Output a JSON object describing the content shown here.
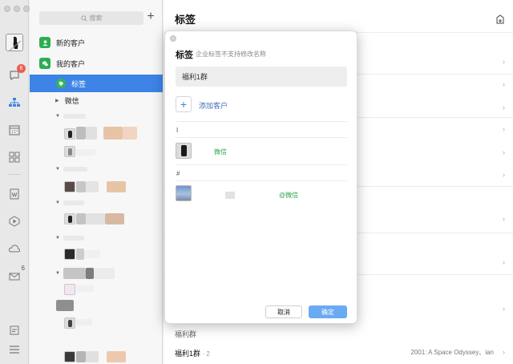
{
  "sidebar": {
    "rail_badges": {
      "messages": "6",
      "mail": "6"
    },
    "search_placeholder": "搜索",
    "items": [
      {
        "label": "新的客户"
      },
      {
        "label": "我的客户"
      },
      {
        "label": "标签"
      },
      {
        "label": "微信"
      }
    ]
  },
  "main": {
    "title": "标签",
    "group_section": "福利群",
    "group_name": "福利1群",
    "group_count": "· 2",
    "group_extra": "2001: A Space Odyssey、ian"
  },
  "dialog": {
    "title": "标签",
    "subtitle": "企业标签不支持修改名称",
    "tag_value": "福利1群",
    "add_label": "添加客户",
    "sections": [
      {
        "index": "I",
        "contact_source": "微信"
      },
      {
        "index": "#",
        "contact_source": "@微信"
      }
    ],
    "cancel_label": "取消",
    "ok_label": "确定"
  },
  "colors": {
    "accent": "#3d84e6",
    "green": "#2aa34a",
    "badge": "#f05b4f"
  }
}
